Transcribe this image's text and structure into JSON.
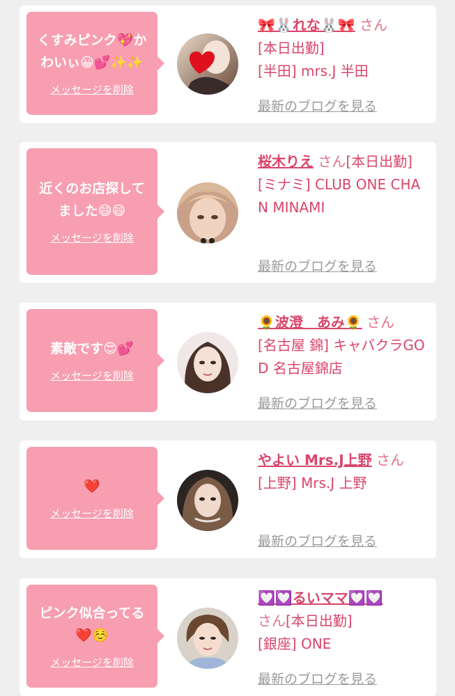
{
  "cards": [
    {
      "message": "くすみピンク💖かわいぃ😀💕✨✨",
      "delete_label": "メッセージを削除",
      "name": "🎀🐰れな🐰🎀",
      "honorific": "さん",
      "status": "[本日出勤]",
      "area": "[半田] mrs.J 半田",
      "blog_label": "最新のブログを見る",
      "avatar_icon": "heart-avatar"
    },
    {
      "message": "近くのお店探してました😄😄",
      "delete_label": "メッセージを削除",
      "name": "桜木りえ",
      "honorific": "さん",
      "status": "[本日出勤]",
      "area": "[ミナミ] CLUB ONE CHAN MINAMI",
      "blog_label": "最新のブログを見る",
      "avatar_icon": "woman-avatar"
    },
    {
      "message": "素敵です😍💕",
      "delete_label": "メッセージを削除",
      "name": "🌻波澄　あみ🌻",
      "honorific": "さん",
      "status": "",
      "area": "[名古屋 錦] キャバクラGOD 名古屋錦店",
      "blog_label": "最新のブログを見る",
      "avatar_icon": "woman-avatar"
    },
    {
      "message": "❤️",
      "delete_label": "メッセージを削除",
      "name": "やよい Mrs.J上野",
      "honorific": "さん",
      "status": "",
      "area": "[上野] Mrs.J 上野",
      "blog_label": "最新のブログを見る",
      "avatar_icon": "woman-avatar"
    },
    {
      "message": "ピンク似合ってる❤️☺️",
      "delete_label": "メッセージを削除",
      "name": "💟💟るいママ💟💟",
      "honorific": "さん",
      "status": "[本日出勤]",
      "area": "[銀座] ONE",
      "blog_label": "最新のブログを見る",
      "avatar_icon": "woman-avatar"
    }
  ],
  "colors": {
    "bubble": "#f79eb0",
    "name": "#d9456b",
    "blog_link": "#9a9a9a",
    "background": "#f0eff0"
  }
}
